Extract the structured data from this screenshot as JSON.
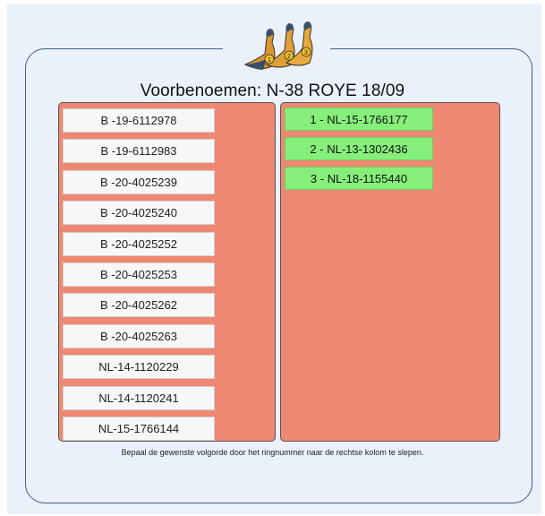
{
  "page": {
    "title": "Voorbenoemen: N-38 ROYE 18/09"
  },
  "left_column": {
    "rings": [
      "B -19-6112978",
      "B -19-6112983",
      "B -20-4025239",
      "B -20-4025240",
      "B -20-4025252",
      "B -20-4025253",
      "B -20-4025262",
      "B -20-4025263",
      "NL-14-1120229",
      "NL-14-1120241",
      "NL-15-1766144"
    ]
  },
  "right_column": {
    "ranked": [
      "1 - NL-15-1766177",
      "2 - NL-13-1302436",
      "3 - NL-18-1155440"
    ]
  },
  "instructions": "Bepaal de gewenste volgorde door het ringnummer naar de rechtse kolom te slepen.",
  "logo": {
    "icon": "three-pigeons-logo",
    "badges": [
      "1",
      "2",
      "3"
    ]
  },
  "colors": {
    "zone": "#ef8873",
    "chip_selected": "#86ef7a",
    "frame": "#3c5f8c",
    "background": "#eaf1fb"
  }
}
